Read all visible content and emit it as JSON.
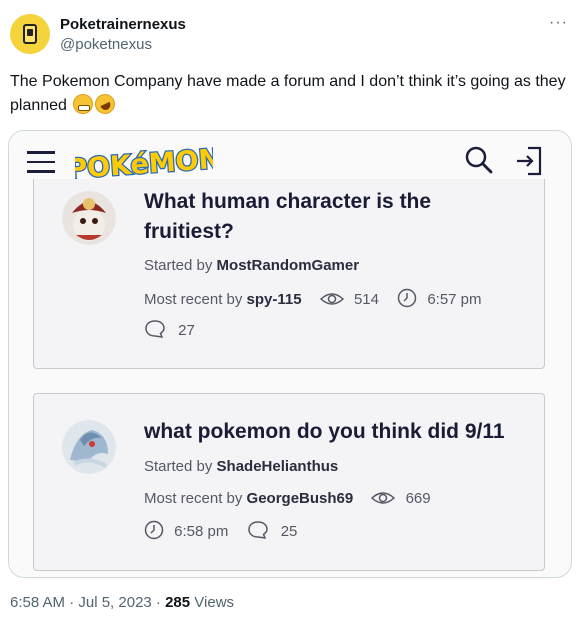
{
  "tweet": {
    "display_name": "Poketrainernexus",
    "handle": "@poketnexus",
    "more_label": "···",
    "text": "The Pokemon Company have made a forum and I don’t think it’s going as they planned",
    "timestamp": "6:58 AM · Jul 5, 2023 · ",
    "views_count": "285",
    "views_label": " Views"
  },
  "app": {
    "logo_text": "POKéMON",
    "icons": [
      "menu-icon",
      "search-icon",
      "login-icon"
    ]
  },
  "posts": [
    {
      "title": "What human character is the fruitiest?",
      "started_prefix": "Started by ",
      "started_by": "MostRandomGamer",
      "recent_prefix": "Most recent by ",
      "recent_by": "spy-115",
      "views": "514",
      "time": "6:57 pm",
      "replies": "27"
    },
    {
      "title": "what pokemon do you think did 9/11",
      "started_prefix": "Started by ",
      "started_by": "ShadeHelianthus",
      "recent_prefix": "Most recent by ",
      "recent_by": "GeorgeBush69",
      "views": "669",
      "time": "6:58 pm",
      "replies": "25"
    }
  ],
  "colors": {
    "logo_yellow": "#ffcb05",
    "logo_blue": "#2a6ab5",
    "title": "#1a1c36",
    "meta": "#555864"
  }
}
